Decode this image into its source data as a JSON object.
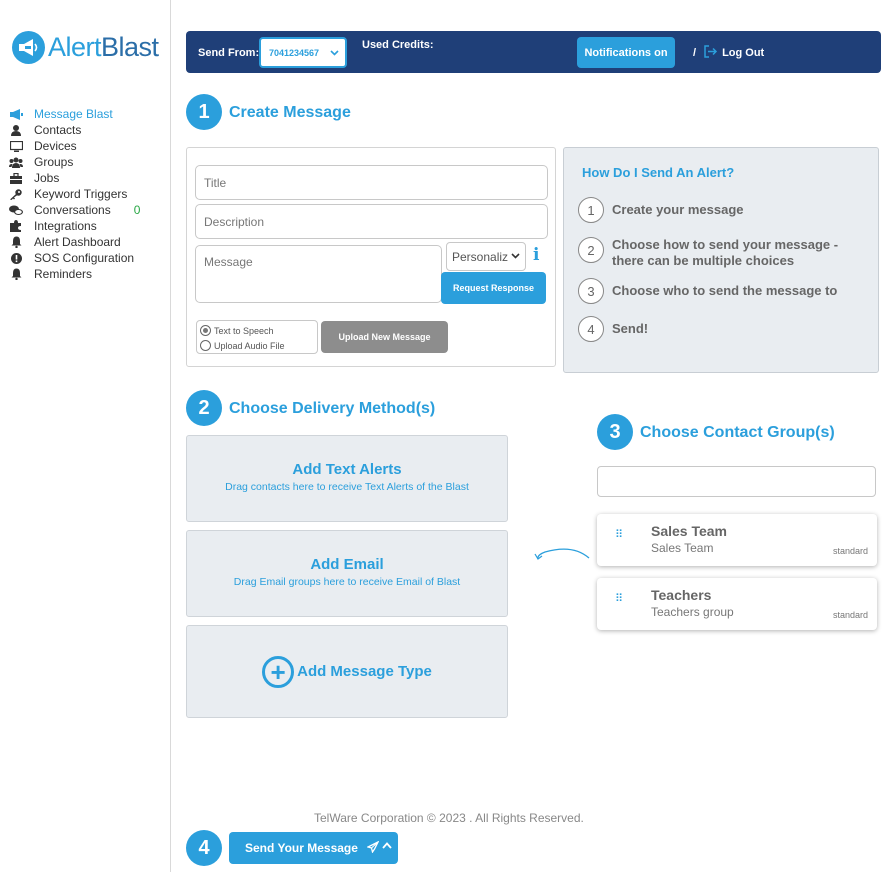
{
  "brand": {
    "name_part1": "Alert",
    "name_part2": "Blast",
    "logo_icon": "megaphone-icon"
  },
  "sidebar": {
    "items": [
      {
        "label": "Message Blast",
        "icon": "megaphone-icon",
        "active": true
      },
      {
        "label": "Contacts",
        "icon": "user-icon"
      },
      {
        "label": "Devices",
        "icon": "monitor-icon"
      },
      {
        "label": "Groups",
        "icon": "users-icon"
      },
      {
        "label": "Jobs",
        "icon": "briefcase-icon"
      },
      {
        "label": "Keyword Triggers",
        "icon": "key-icon"
      },
      {
        "label": "Conversations",
        "icon": "comments-icon",
        "badge": "0"
      },
      {
        "label": "Integrations",
        "icon": "puzzle-icon"
      },
      {
        "label": "Alert Dashboard",
        "icon": "bell-icon"
      },
      {
        "label": "SOS Configuration",
        "icon": "exclamation-circle-icon"
      },
      {
        "label": "Reminders",
        "icon": "bell-icon"
      }
    ]
  },
  "topbar": {
    "send_from_label": "Send From:",
    "send_from_value": "7041234567",
    "used_credits_label": "Used Credits:",
    "notifications_label": "Notifications on",
    "separator": "/",
    "logout_label": "Log Out"
  },
  "step1": {
    "number": "1",
    "title": "Create Message",
    "title_placeholder": "Title",
    "description_placeholder": "Description",
    "message_placeholder": "Message",
    "personalize_value": "Personaliz",
    "info_icon": "i",
    "request_response_label": "Request Response",
    "radio_tts": "Text to Speech",
    "radio_audio": "Upload Audio File",
    "upload_button": "Upload New Message"
  },
  "help": {
    "title": "How Do I Send An Alert?",
    "steps": [
      {
        "num": "1",
        "text": "Create your message"
      },
      {
        "num": "2",
        "text": "Choose how to send your message - there can be multiple choices"
      },
      {
        "num": "3",
        "text": "Choose who to send the message to"
      },
      {
        "num": "4",
        "text": "Send!"
      }
    ]
  },
  "step2": {
    "number": "2",
    "title": "Choose Delivery Method(s)",
    "cards": [
      {
        "title": "Add Text Alerts",
        "sub": "Drag contacts here to receive Text Alerts of the Blast"
      },
      {
        "title": "Add Email",
        "sub": "Drag Email groups here to receive Email of Blast"
      }
    ],
    "add_type_label": "Add Message Type"
  },
  "step3": {
    "number": "3",
    "title": "Choose Contact Group(s)",
    "search_value": "",
    "groups": [
      {
        "name": "Sales Team",
        "desc": "Sales Team",
        "tag": "standard"
      },
      {
        "name": "Teachers",
        "desc": "Teachers group",
        "tag": "standard"
      }
    ]
  },
  "footer": {
    "text": "TelWare Corporation © 2023 . All Rights Reserved."
  },
  "step4": {
    "number": "4",
    "send_label": "Send Your Message"
  },
  "colors": {
    "accent": "#2b9fdc",
    "topbar": "#1f3f78",
    "panel": "#e9edf1",
    "badge_green": "#28a745"
  }
}
